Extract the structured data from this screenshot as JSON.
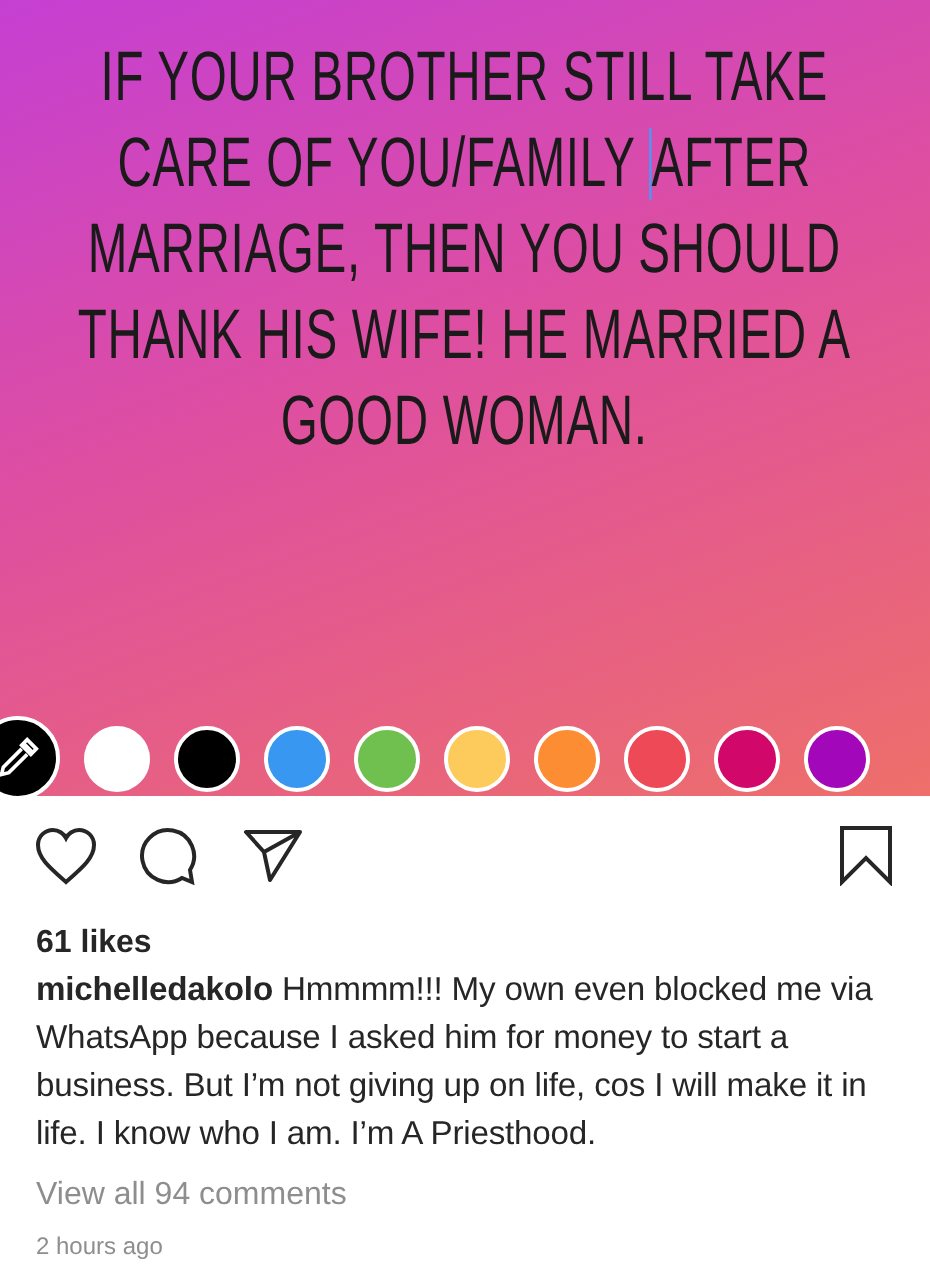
{
  "story": {
    "lines": [
      {
        "parts": [
          "IF YOUR BROTHER STILL TAKE"
        ],
        "cursor": false
      },
      {
        "parts": [
          "CARE OF YOU/FAMILY ",
          "AFTER"
        ],
        "cursor": true
      },
      {
        "parts": [
          "MARRIAGE, THEN YOU SHOULD"
        ],
        "cursor": false
      },
      {
        "parts": [
          "THANK HIS WIFE! HE MARRIED A"
        ],
        "cursor": false
      },
      {
        "parts": [
          "GOOD WOMAN."
        ],
        "cursor": false
      }
    ],
    "swatches": [
      {
        "color": "#ffffff"
      },
      {
        "color": "#000000"
      },
      {
        "color": "#3897f0"
      },
      {
        "color": "#70c050"
      },
      {
        "color": "#fdcb5c"
      },
      {
        "color": "#fd8d32"
      },
      {
        "color": "#ed4956"
      },
      {
        "color": "#d10869"
      },
      {
        "color": "#a307ba"
      }
    ]
  },
  "likes": "61 likes",
  "caption": "**michelledakolo** Hmmmm!!! My own even blocked me via WhatsApp because I asked him for money to start a business. But I’m not giving up on life, cos I will make it in life. I know who I am. I’m A Priesthood.",
  "view_comments": "View all 94 comments",
  "time": "2 hours ago"
}
